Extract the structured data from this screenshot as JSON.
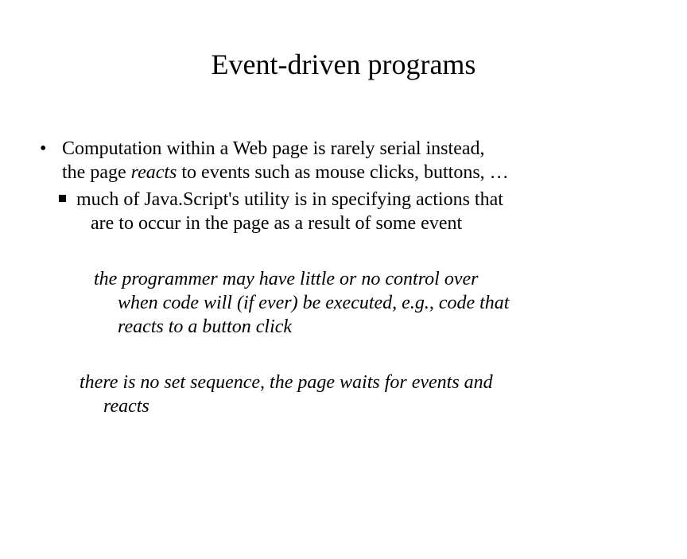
{
  "title": "Event-driven programs",
  "bullet1_line1": "Computation within a Web page is rarely serial instead,",
  "bullet1_line2_pre": "the page ",
  "bullet1_line2_italic": "reacts",
  "bullet1_line2_post": " to events such as mouse clicks, buttons, …",
  "sub1_line1": "much of Java.Script's utility is in specifying actions that",
  "sub1_line2": "are to occur in the page as a result of some event",
  "para1_line1": "the programmer may have little or no control over",
  "para1_line2a": "when code will (if ever) be executed, e.g., code that",
  "para1_line2b": "reacts to a button click",
  "para2_line1": "there is no set sequence, the page waits for events and",
  "para2_line2": "reacts"
}
